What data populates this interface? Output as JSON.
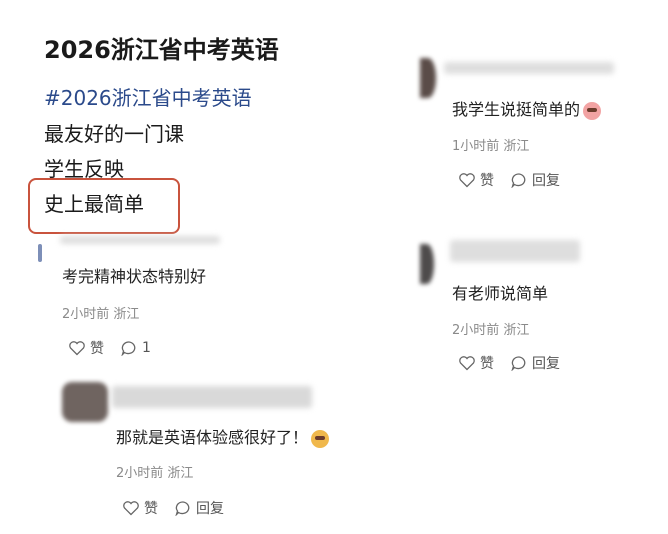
{
  "post": {
    "title": "2026浙江省中考英语",
    "hashtag": "#2026浙江省中考英语",
    "lines": [
      "最友好的一门课",
      "学生反映",
      "史上最简单"
    ]
  },
  "comments": [
    {
      "text": "考完精神状态特别好",
      "meta": "2小时前 浙江",
      "like_label": "赞",
      "reply_label": "1"
    },
    {
      "text": "那就是英语体验感很好了！",
      "meta": "2小时前 浙江",
      "like_label": "赞",
      "reply_label": "回复",
      "emoji": "nerd-face-emoji"
    },
    {
      "text": "我学生说挺简单的",
      "meta": "1小时前 浙江",
      "like_label": "赞",
      "reply_label": "回复",
      "emoji": "clown-face-emoji"
    },
    {
      "text": "有老师说简单",
      "meta": "2小时前 浙江",
      "like_label": "赞",
      "reply_label": "回复"
    }
  ],
  "colors": {
    "hashtag": "#2b4a8b",
    "highlight_border": "#c9533d",
    "meta": "#8a8a8a"
  }
}
